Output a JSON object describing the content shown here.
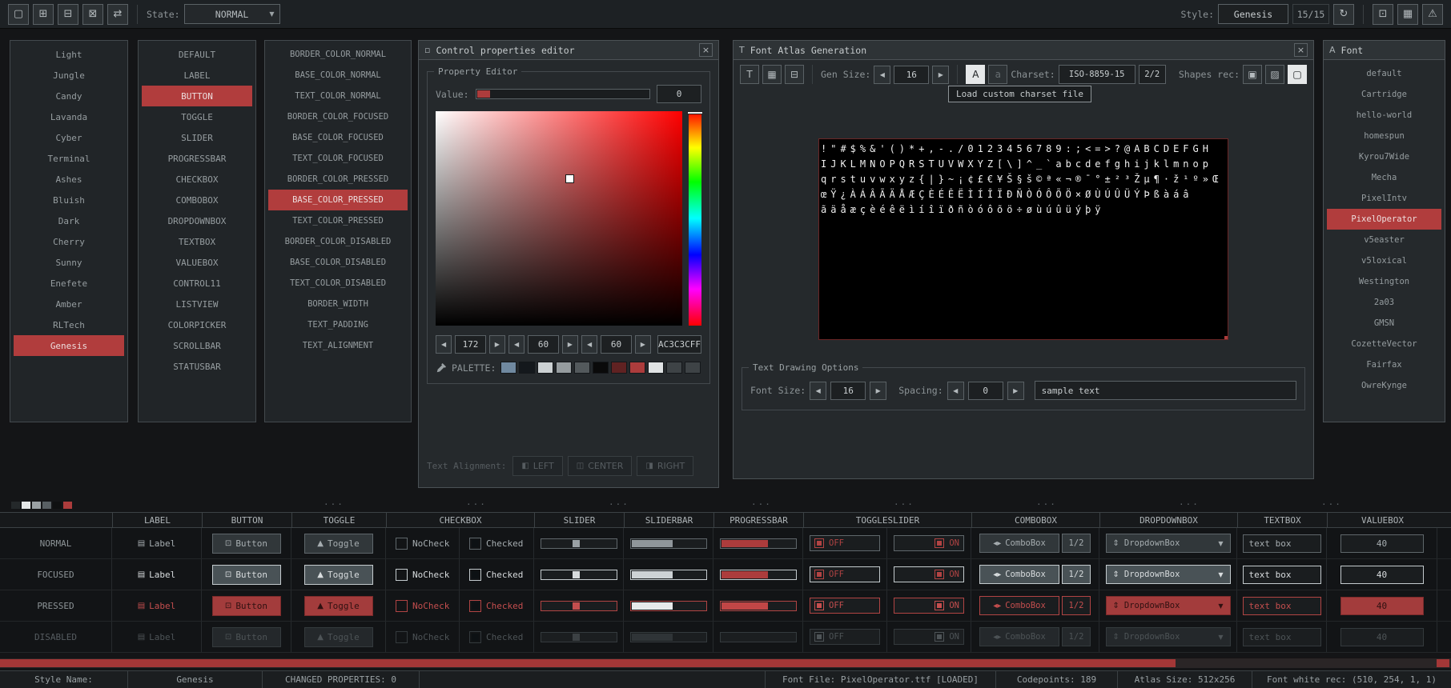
{
  "toolbar": {
    "state_label": "State:",
    "state_value": "NORMAL",
    "style_label": "Style:",
    "style_name": "Genesis",
    "style_count": "15/15"
  },
  "icons": {
    "new": "▢",
    "open": "⊞",
    "save": "⊟",
    "export": "⊠",
    "random": "⇄",
    "reload": "↻",
    "screenshot": "⊡",
    "table_view": "▦",
    "warning": "⚠",
    "left": "◀",
    "right": "▶",
    "down": "▼",
    "close": "×",
    "window": "▫",
    "font_gen": "T",
    "atlas_export": "▦",
    "atlas_image": "⊟",
    "charset_load": "A",
    "charset_default": "a",
    "shapes_fill": "▣",
    "shapes_pattern": "▨",
    "shapes_empty": "▢",
    "label": "▤",
    "button": "⊡",
    "toggle": "▲",
    "combo": "◂▸",
    "dropdown": "⇕",
    "title_font": "A"
  },
  "styles_list": {
    "items": [
      {
        "label": "Light"
      },
      {
        "label": "Jungle"
      },
      {
        "label": "Candy"
      },
      {
        "label": "Lavanda"
      },
      {
        "label": "Cyber"
      },
      {
        "label": "Terminal"
      },
      {
        "label": "Ashes"
      },
      {
        "label": "Bluish"
      },
      {
        "label": "Dark"
      },
      {
        "label": "Cherry"
      },
      {
        "label": "Sunny"
      },
      {
        "label": "Enefete"
      },
      {
        "label": "Amber"
      },
      {
        "label": "RLTech"
      },
      {
        "label": "Genesis",
        "selected": true
      }
    ]
  },
  "controls_list": {
    "items": [
      {
        "label": "DEFAULT"
      },
      {
        "label": "LABEL"
      },
      {
        "label": "BUTTON",
        "selected": true
      },
      {
        "label": "TOGGLE"
      },
      {
        "label": "SLIDER"
      },
      {
        "label": "PROGRESSBAR"
      },
      {
        "label": "CHECKBOX"
      },
      {
        "label": "COMBOBOX"
      },
      {
        "label": "DROPDOWNBOX"
      },
      {
        "label": "TEXTBOX"
      },
      {
        "label": "VALUEBOX"
      },
      {
        "label": "CONTROL11"
      },
      {
        "label": "LISTVIEW"
      },
      {
        "label": "COLORPICKER"
      },
      {
        "label": "SCROLLBAR"
      },
      {
        "label": "STATUSBAR"
      }
    ]
  },
  "props_list": {
    "items": [
      {
        "label": "BORDER_COLOR_NORMAL"
      },
      {
        "label": "BASE_COLOR_NORMAL"
      },
      {
        "label": "TEXT_COLOR_NORMAL"
      },
      {
        "label": "BORDER_COLOR_FOCUSED"
      },
      {
        "label": "BASE_COLOR_FOCUSED"
      },
      {
        "label": "TEXT_COLOR_FOCUSED"
      },
      {
        "label": "BORDER_COLOR_PRESSED"
      },
      {
        "label": "BASE_COLOR_PRESSED",
        "selected": true
      },
      {
        "label": "TEXT_COLOR_PRESSED"
      },
      {
        "label": "BORDER_COLOR_DISABLED"
      },
      {
        "label": "BASE_COLOR_DISABLED"
      },
      {
        "label": "TEXT_COLOR_DISABLED"
      },
      {
        "label": "BORDER_WIDTH"
      },
      {
        "label": "TEXT_PADDING"
      },
      {
        "label": "TEXT_ALIGNMENT"
      }
    ]
  },
  "prop_editor": {
    "title": "Control properties editor",
    "group": "Property Editor",
    "value_label": "Value:",
    "value": "0",
    "r": "172",
    "g": "60",
    "b": "60",
    "hex": "AC3C3CFF",
    "palette_label": "PALETTE:",
    "palette": [
      "#7089a0",
      "#14181c",
      "#ccd1d3",
      "#969c9f",
      "#53595c",
      "#0a0a0a",
      "#602222",
      "#ac3c3c",
      "#e0e3e4",
      "#3e4346",
      "#3e4346"
    ],
    "text_align_label": "Text Alignment:",
    "align": [
      {
        "label": "LEFT",
        "icon": "◧"
      },
      {
        "label": "CENTER",
        "icon": "◫"
      },
      {
        "label": "RIGHT",
        "icon": "◨"
      }
    ]
  },
  "font_atlas": {
    "title": "Font Atlas Generation",
    "gen_size_label": "Gen Size:",
    "gen_size": "16",
    "charset_label": "Charset:",
    "charset": "ISO-8859-15",
    "charset_pages": "2/2",
    "shapes_label": "Shapes rec:",
    "tooltip": "Load custom charset file",
    "atlas_lines": [
      "!\"#$%&'()*+,-./0123456789:;<=>?@ABCDEFGH",
      "IJKLMNOPQRSTUVWXYZ[\\]^_`abcdefghijklmnop",
      "qrstuvwxyz{|}~¡¢£€¥Š§š©ª«¬­®¯°±²³Žµ¶·ž¹º»Œ",
      "œŸ¿ÀÁÂÃÄÅÆÇÈÉÊËÌÍÎÏÐÑÒÓÔÕÖ×ØÙÚÛÜÝÞßàáâ",
      "ãäåæçèéêëìíîïðñòóôõö÷øùúûüýþÿ"
    ],
    "options_title": "Text Drawing Options",
    "font_size_label": "Font Size:",
    "font_size": "16",
    "spacing_label": "Spacing:",
    "spacing": "0",
    "sample_text": "sample text"
  },
  "font_panel": {
    "title": "Font",
    "items": [
      {
        "label": "default"
      },
      {
        "label": "Cartridge"
      },
      {
        "label": "hello-world"
      },
      {
        "label": "homespun"
      },
      {
        "label": "Kyrou7Wide"
      },
      {
        "label": "Mecha"
      },
      {
        "label": "PixelIntv"
      },
      {
        "label": "PixelOperator",
        "selected": true
      },
      {
        "label": "v5easter"
      },
      {
        "label": "v5loxical"
      },
      {
        "label": "Westington"
      },
      {
        "label": "2a03"
      },
      {
        "label": "GMSN"
      },
      {
        "label": "CozetteVector"
      },
      {
        "label": "Fairfax"
      },
      {
        "label": "OwreKynge"
      }
    ]
  },
  "preview": {
    "headers": [
      {
        "label": "LABEL",
        "span": 1
      },
      {
        "label": "BUTTON",
        "span": 1
      },
      {
        "label": "TOGGLE",
        "span": 1
      },
      {
        "label": "CHECKBOX",
        "span": 2
      },
      {
        "label": "SLIDER",
        "span": 1
      },
      {
        "label": "SLIDERBAR",
        "span": 1
      },
      {
        "label": "PROGRESSBAR",
        "span": 1
      },
      {
        "label": "TOGGLESLIDER",
        "span": 2
      },
      {
        "label": "COMBOBOX",
        "span": 1
      },
      {
        "label": "DROPDOWNBOX",
        "span": 1
      },
      {
        "label": "TEXTBOX",
        "span": 1
      },
      {
        "label": "VALUEBOX",
        "span": 1
      }
    ],
    "rows": [
      {
        "state": "NORMAL",
        "cls": "st-normal"
      },
      {
        "state": "FOCUSED",
        "cls": "st-focused"
      },
      {
        "state": "PRESSED",
        "cls": "st-pressed"
      },
      {
        "state": "DISABLED",
        "cls": "st-disabled"
      }
    ],
    "label_text": "Label",
    "button_text": "Button",
    "toggle_text": "Toggle",
    "nocheck_text": "NoCheck",
    "checked_text": "Checked",
    "off_text": "OFF",
    "on_text": "ON",
    "combobox_text": "ComboBox",
    "combobox_count": "1/2",
    "dropdown_text": "DropdownBox",
    "textbox_text": "text box",
    "valuebox_text": "40",
    "mini_palette": [
      "#24282a",
      "#e4e6e7",
      "#9ba1a4",
      "#585f63",
      "#0f1011",
      "#ac3c3c"
    ]
  },
  "statusbar": {
    "items": [
      "Style Name:",
      "Genesis",
      "CHANGED PROPERTIES: 0",
      "",
      "Font File: PixelOperator.ttf [LOADED]",
      "Codepoints: 189",
      "Atlas Size: 512x256",
      "Font white rec: (510, 254, 1, 1)"
    ]
  }
}
